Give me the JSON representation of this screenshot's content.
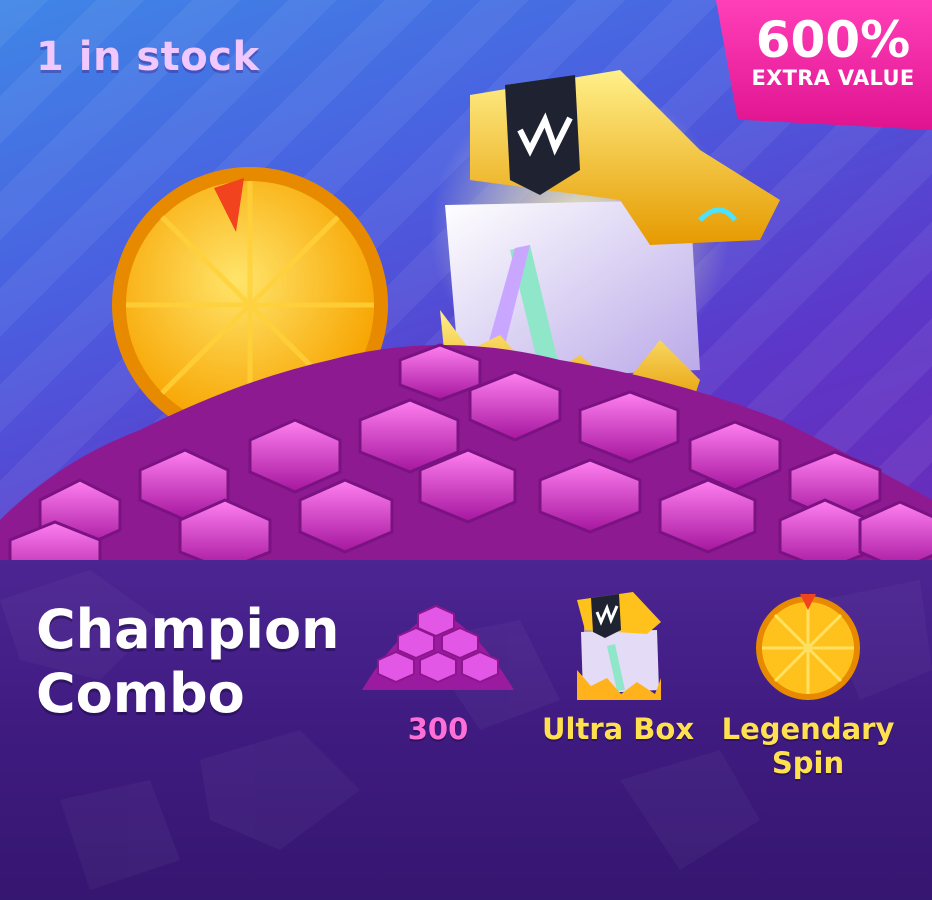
{
  "offer": {
    "stock_text": "1 in stock",
    "badge_percent": "600%",
    "badge_label": "EXTRA VALUE",
    "bundle_name": "Champion Combo"
  },
  "items": [
    {
      "icon": "gem-pile-icon",
      "label": "300"
    },
    {
      "icon": "ultra-box-icon",
      "label": "Ultra Box"
    },
    {
      "icon": "legendary-spin-wheel-icon",
      "label": "Legendary Spin"
    }
  ],
  "colors": {
    "hero_top": "#3f86e6",
    "hero_bottom": "#6a2bb8",
    "panel": "#421d84",
    "badge": "#e8189a",
    "gem": "#d63fd6",
    "gold": "#ffc21c",
    "gem_label": "#ff6fd8",
    "gold_label": "#ffe150"
  }
}
